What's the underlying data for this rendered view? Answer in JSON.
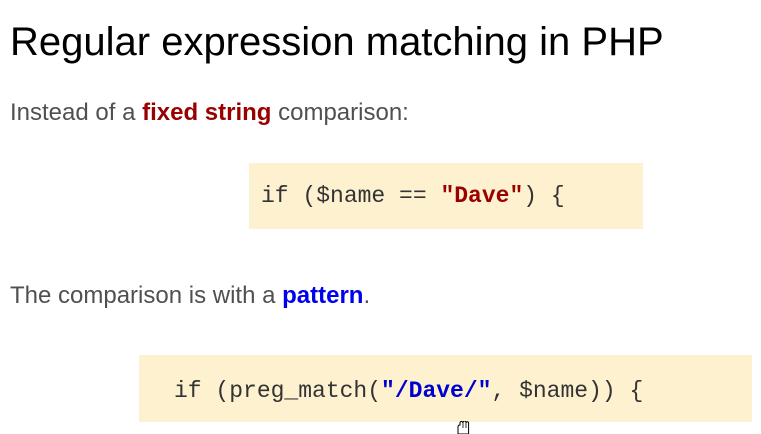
{
  "slide": {
    "title": "Regular expression matching in PHP",
    "intro": {
      "before": "Instead of a ",
      "highlight": "fixed string",
      "after": " comparison:",
      "highlight_color": "#990000"
    },
    "code_fixed": {
      "prefix": "if ($name == ",
      "string": "\"Dave\"",
      "suffix": ") {",
      "string_color": "#990000"
    },
    "pattern_line": {
      "before": "The comparison is with a ",
      "highlight": "pattern",
      "after": ".",
      "highlight_color": "#0000ee"
    },
    "code_pattern": {
      "prefix": "if (preg_match(",
      "string": "\"/Dave/\"",
      "suffix": ", $name)) {",
      "string_color": "#0000cc"
    },
    "code_background": "#fdf1d0",
    "pointer_icon": "hand-cursor-icon"
  }
}
